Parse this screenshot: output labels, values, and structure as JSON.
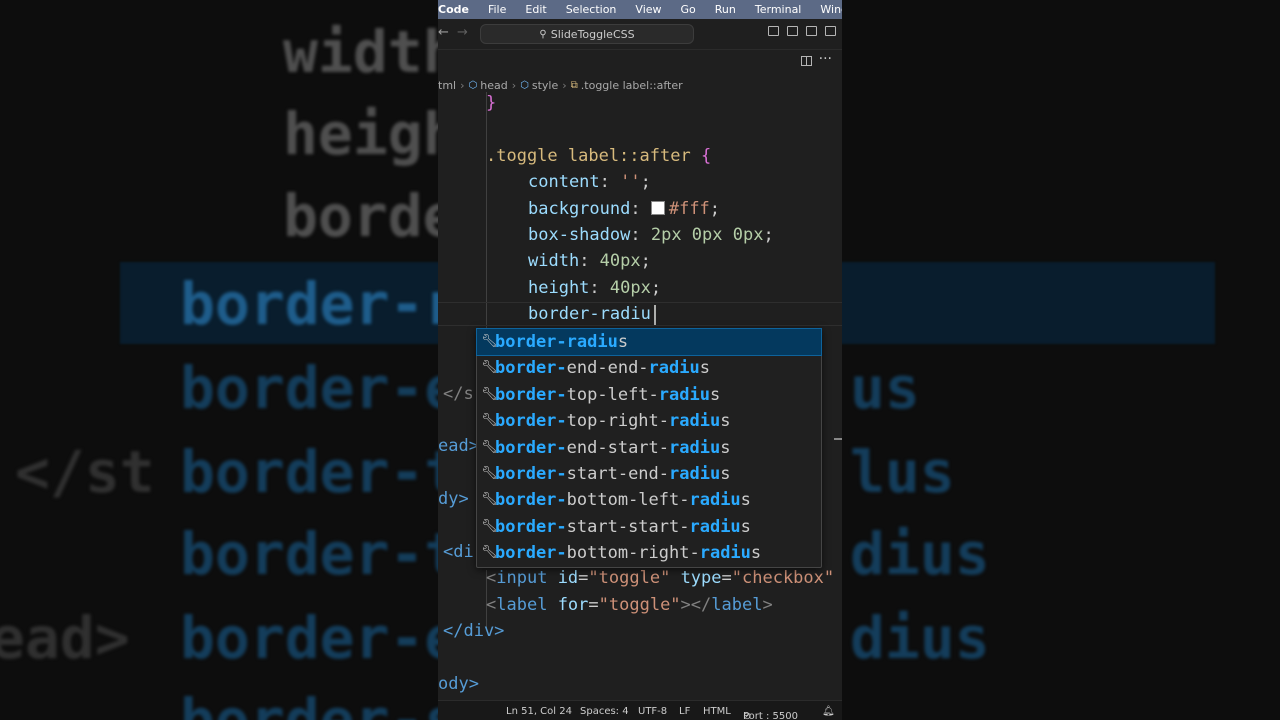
{
  "menubar": {
    "app_name": "Code",
    "items": [
      "File",
      "Edit",
      "Selection",
      "View",
      "Go",
      "Run",
      "Terminal",
      "Wind"
    ]
  },
  "titlebar": {
    "back_icon": "arrow-left-icon",
    "forward_icon": "arrow-right-icon",
    "search_text": "SlideToggleCSS"
  },
  "breadcrumb": {
    "file": "tml",
    "items": [
      "head",
      "style",
      ".toggle label::after"
    ]
  },
  "editor": {
    "lines": {
      "l0": "}",
      "l2_sel": ".toggle label::after",
      "l2_brace": "{",
      "l3_prop": "content",
      "l3_val": "''",
      "l4_prop": "background",
      "l4_val": "#fff",
      "l5_prop": "box-shadow",
      "l5_val": "2px 0px 0px",
      "l6_prop": "width",
      "l6_val": "40px",
      "l7_prop": "height",
      "l7_val": "40px",
      "l8_text": "border-radiu",
      "l9_text": "</s",
      "l10_text": "ead>",
      "l11_text": "dy>",
      "l12_text": "<di",
      "l13_input_attr1": "id",
      "l13_input_val1": "\"toggle\"",
      "l13_input_attr2": "type",
      "l13_input_val2": "\"checkbox\"",
      "l14_label_attr": "for",
      "l14_label_val": "\"toggle\"",
      "l15_text": "</div>",
      "l17_text": "ody>"
    },
    "background_swatch_color": "#ffffff"
  },
  "autocomplete": {
    "items": [
      {
        "pre": "border-radiu",
        "post": "s",
        "mid": ""
      },
      {
        "pre": "border-",
        "mid": "end-end-",
        "hl2": "radiu",
        "post": "s"
      },
      {
        "pre": "border-",
        "mid": "top-left-",
        "hl2": "radiu",
        "post": "s"
      },
      {
        "pre": "border-",
        "mid": "top-right-",
        "hl2": "radiu",
        "post": "s"
      },
      {
        "pre": "border-",
        "mid": "end-start-",
        "hl2": "radiu",
        "post": "s"
      },
      {
        "pre": "border-",
        "mid": "start-end-",
        "hl2": "radiu",
        "post": "s"
      },
      {
        "pre": "border-",
        "mid": "bottom-left-",
        "hl2": "radiu",
        "post": "s"
      },
      {
        "pre": "border-",
        "mid": "start-start-",
        "hl2": "radiu",
        "post": "s"
      },
      {
        "pre": "border-",
        "mid": "bottom-right-",
        "hl2": "radiu",
        "post": "s"
      }
    ],
    "item_icon": "wrench-icon"
  },
  "statusbar": {
    "position": "Ln 51, Col 24",
    "spaces": "Spaces: 4",
    "encoding": "UTF-8",
    "eol": "LF",
    "language": "HTML",
    "port": "Port : 5500"
  },
  "background_zoom": {
    "lines": [
      "width",
      "heigh",
      "borde",
      "border-r",
      "border-e",
      "</s",
      "border-t",
      "border-t",
      "border-e",
      "border-s"
    ],
    "tail_texts": [
      "us",
      "lus",
      "dius",
      "dius",
      "dius"
    ],
    "left_texts": [
      "</st",
      "ead>"
    ]
  }
}
